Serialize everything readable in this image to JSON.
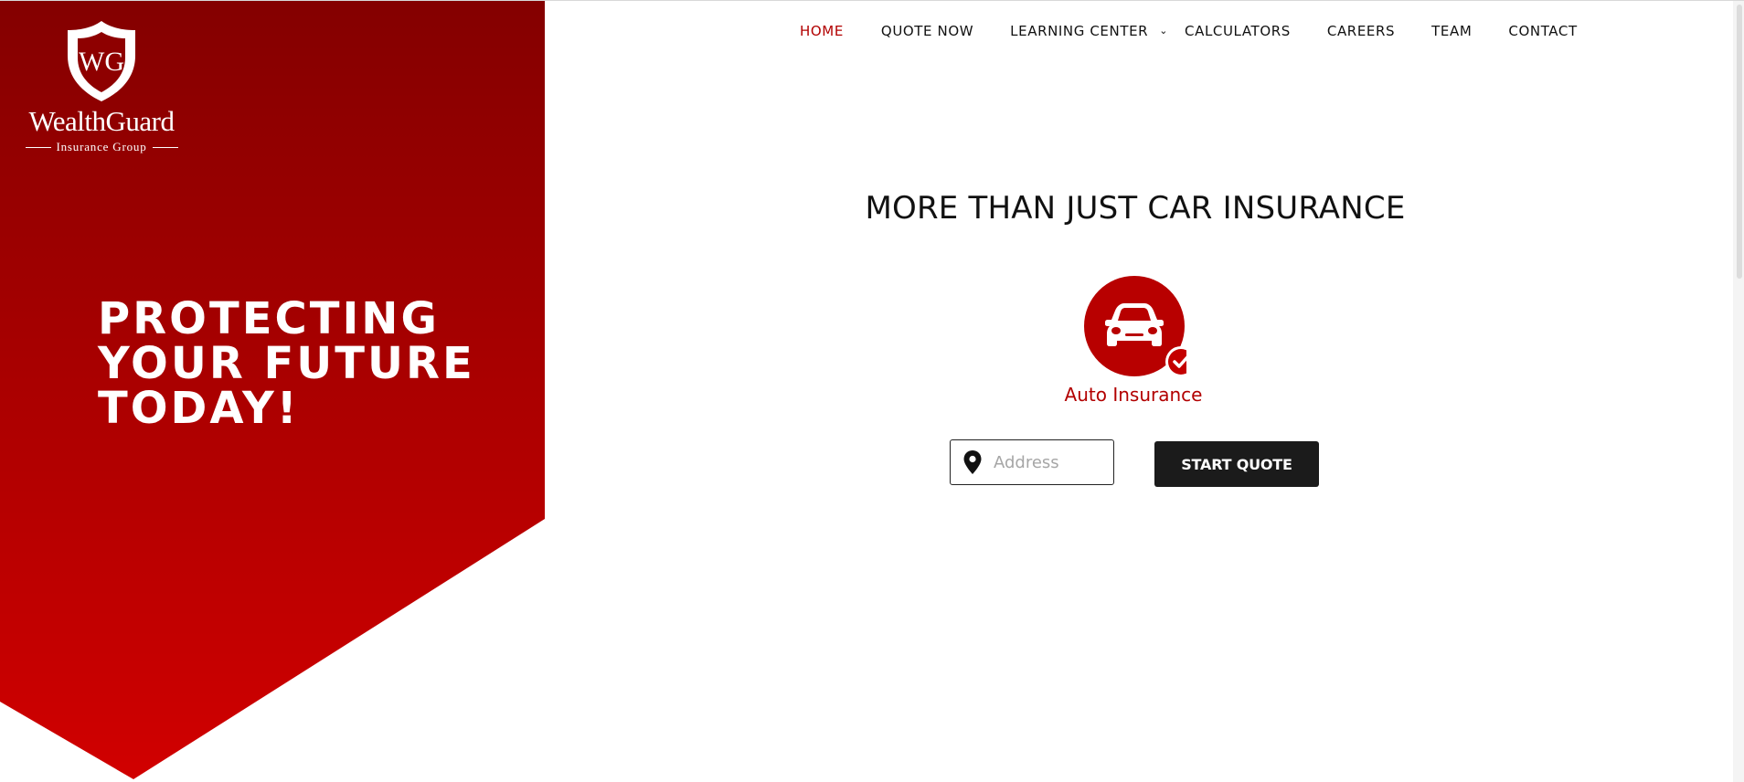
{
  "brand": {
    "name": "WealthGuard",
    "tagline": "Insurance Group",
    "monogram": "WG",
    "primary_color": "#b20000",
    "dark_color": "#1b1b1b"
  },
  "hero": {
    "title": "PROTECTING YOUR FUTURE TODAY!"
  },
  "nav": {
    "items": [
      {
        "label": "HOME",
        "active": true
      },
      {
        "label": "QUOTE NOW"
      },
      {
        "label": "LEARNING CENTER",
        "icon": "chevron-down-icon"
      },
      {
        "label": "CALCULATORS"
      },
      {
        "label": "CAREERS"
      },
      {
        "label": "TEAM"
      },
      {
        "label": "CONTACT"
      }
    ]
  },
  "main": {
    "headline": "MORE THAN JUST CAR INSURANCE",
    "product": {
      "label": "Auto Insurance",
      "icon": "car-icon",
      "badge_icon": "check-icon",
      "selected": true
    },
    "address_field": {
      "placeholder": "Address",
      "value": "",
      "icon": "map-pin-icon"
    },
    "start_button_label": "START QUOTE"
  }
}
